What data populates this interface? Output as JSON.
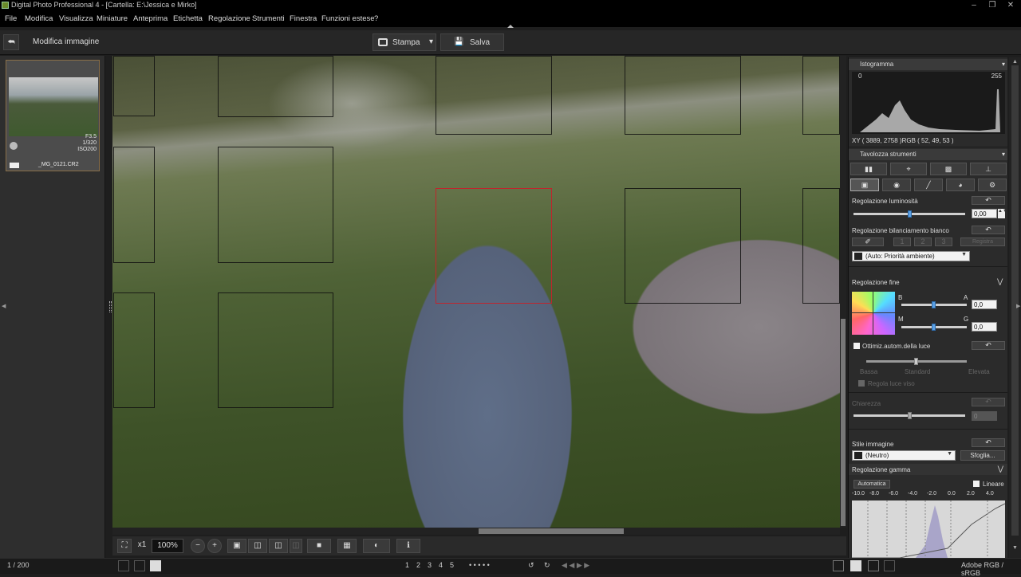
{
  "window": {
    "title": "Digital Photo Professional 4 - [Cartella: E:\\Jessica e Mirko]",
    "min_icon": "minimize-icon",
    "max_icon": "maximize-icon",
    "close_icon": "close-icon"
  },
  "menu": {
    "items": [
      "File",
      "Modifica",
      "Visualizza",
      "Miniature",
      "Anteprima",
      "Etichetta",
      "Regolazione",
      "Strumenti",
      "Finestra",
      "Funzioni estese",
      "?"
    ]
  },
  "toolbar": {
    "back_icon": "back-arrow-icon",
    "page_title": "Modifica immagine",
    "print_label": "Stampa",
    "save_label": "Salva"
  },
  "thumbnail": {
    "aperture": "F3.5",
    "shutter": "1/320",
    "iso": "ISO200",
    "filename": "_MG_0121.CR2"
  },
  "bottom_toolbar": {
    "zoom_x1": "x1",
    "zoom_value": "100%",
    "colors": {
      "accent": "#5aa0e6",
      "af_selected": "#c0242c",
      "thumb_border": "#8a6f48"
    }
  },
  "status": {
    "page_count": "1 / 200",
    "ratings": [
      "1",
      "2",
      "3",
      "4",
      "5"
    ],
    "color_space": "Adobe RGB / sRGB"
  },
  "histogram": {
    "header": "Istogramma",
    "min_label": "0",
    "max_label": "255",
    "xy_readout": "XY ( 3889, 2758 )RGB (  52,  49,  53 )"
  },
  "tools": {
    "header": "Tavolozza strumenti",
    "brightness_label": "Regolazione luminosità",
    "brightness_value": "0,00",
    "wb_label": "Regolazione bilanciamento bianco",
    "wb_buttons": [
      "1",
      "2",
      "3",
      "Registra"
    ],
    "wb_mode": "(Auto: Priorità ambiente)",
    "fine_label": "Regolazione fine",
    "fine_b": "B",
    "fine_a": "A",
    "fine_m": "M",
    "fine_g": "G",
    "fine_ba_value": "0,0",
    "fine_mg_value": "0,0",
    "alo_label": "Ottimiz.autom.della luce",
    "alo_levels": [
      "Bassa",
      "Standard",
      "Elevata"
    ],
    "alo_sub": "Regola luce viso",
    "clarity_label": "Chiarezza",
    "clarity_value": "0",
    "style_label": "Stile immagine",
    "style_value": "(Neutro)",
    "style_browse": "Sfoglia...",
    "gamma_label": "Regolazione gamma",
    "gamma_auto": "Automatica",
    "gamma_linear": "Lineare",
    "gamma_ticks": [
      "-10.0",
      "-8.0",
      "-6.0",
      "-4.0",
      "-2.0",
      "0.0",
      "2.0",
      "4.0"
    ]
  }
}
